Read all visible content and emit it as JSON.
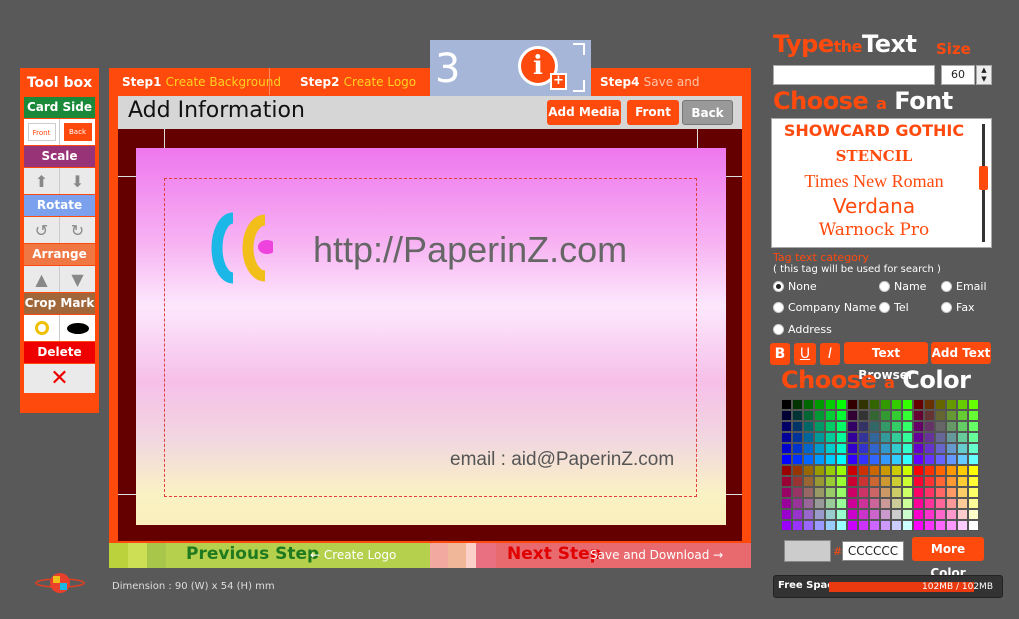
{
  "toolbox": {
    "title": "Tool box",
    "card_side": "Card Side",
    "front_mini": "Front",
    "back_mini": "Back",
    "scale": "Scale",
    "rotate": "Rotate",
    "arrange": "Arrange",
    "crop_mark": "Crop Mark",
    "delete": "Delete"
  },
  "steps": {
    "step1_num": "Step1",
    "step1_label": "Create Background",
    "step2_num": "Step2",
    "step2_label": "Create Logo",
    "step3_num": "3",
    "step4_num": "Step4",
    "step4_label": "Save and Download"
  },
  "header": {
    "title": "Add Information",
    "add_media": "Add Media",
    "front": "Front",
    "back": "Back"
  },
  "card": {
    "url_text": "http://PaperinZ.com",
    "email_text": "email : aid@PaperinZ.com"
  },
  "nav": {
    "previous_step": "Previous Step",
    "previous_target": "← Create Logo",
    "next_step": "Next Step",
    "next_target": "Save and Download →"
  },
  "dimension": "Dimension : 90 (W) x 54 (H) mm",
  "text_panel": {
    "type_1": "Type",
    "type_2": "the",
    "type_3": "Text",
    "size_label": "Size",
    "text_value": "",
    "size_value": "60"
  },
  "font_panel": {
    "choose_1": "Choose",
    "choose_2": "a",
    "choose_3": "Font",
    "fonts": [
      "SHOWCARD GOTHIC",
      "STENCIL",
      "Times New Roman",
      "Verdana",
      "Warnock Pro"
    ]
  },
  "tag": {
    "title": "Tag text category",
    "note": "( this tag will be used for search )",
    "options": [
      "None",
      "Name",
      "Email",
      "Company Name",
      "Tel",
      "Fax",
      "Address"
    ]
  },
  "format": {
    "bold": "B",
    "underline": "U",
    "italic": "I",
    "text_browser": "Text Browser",
    "add_text": "Add Text"
  },
  "color_panel": {
    "choose_1": "Choose",
    "choose_2": "a",
    "choose_3": "Color",
    "hash": "#",
    "hex_value": "CCCCCC",
    "more_color": "More Color",
    "selected_color": "#cccccc"
  },
  "free_space": {
    "label": "Free Space",
    "value": "102MB / 102MB",
    "used_fraction": 1.0
  },
  "colors": {
    "accent": "#ff4a0e",
    "card_side": "#1a8a3a",
    "scale": "#993377",
    "rotate": "#7aa0ee",
    "arrange": "#ee7744",
    "crop_mark": "#a0673a",
    "delete": "#ee0000",
    "stage": "#650000"
  }
}
